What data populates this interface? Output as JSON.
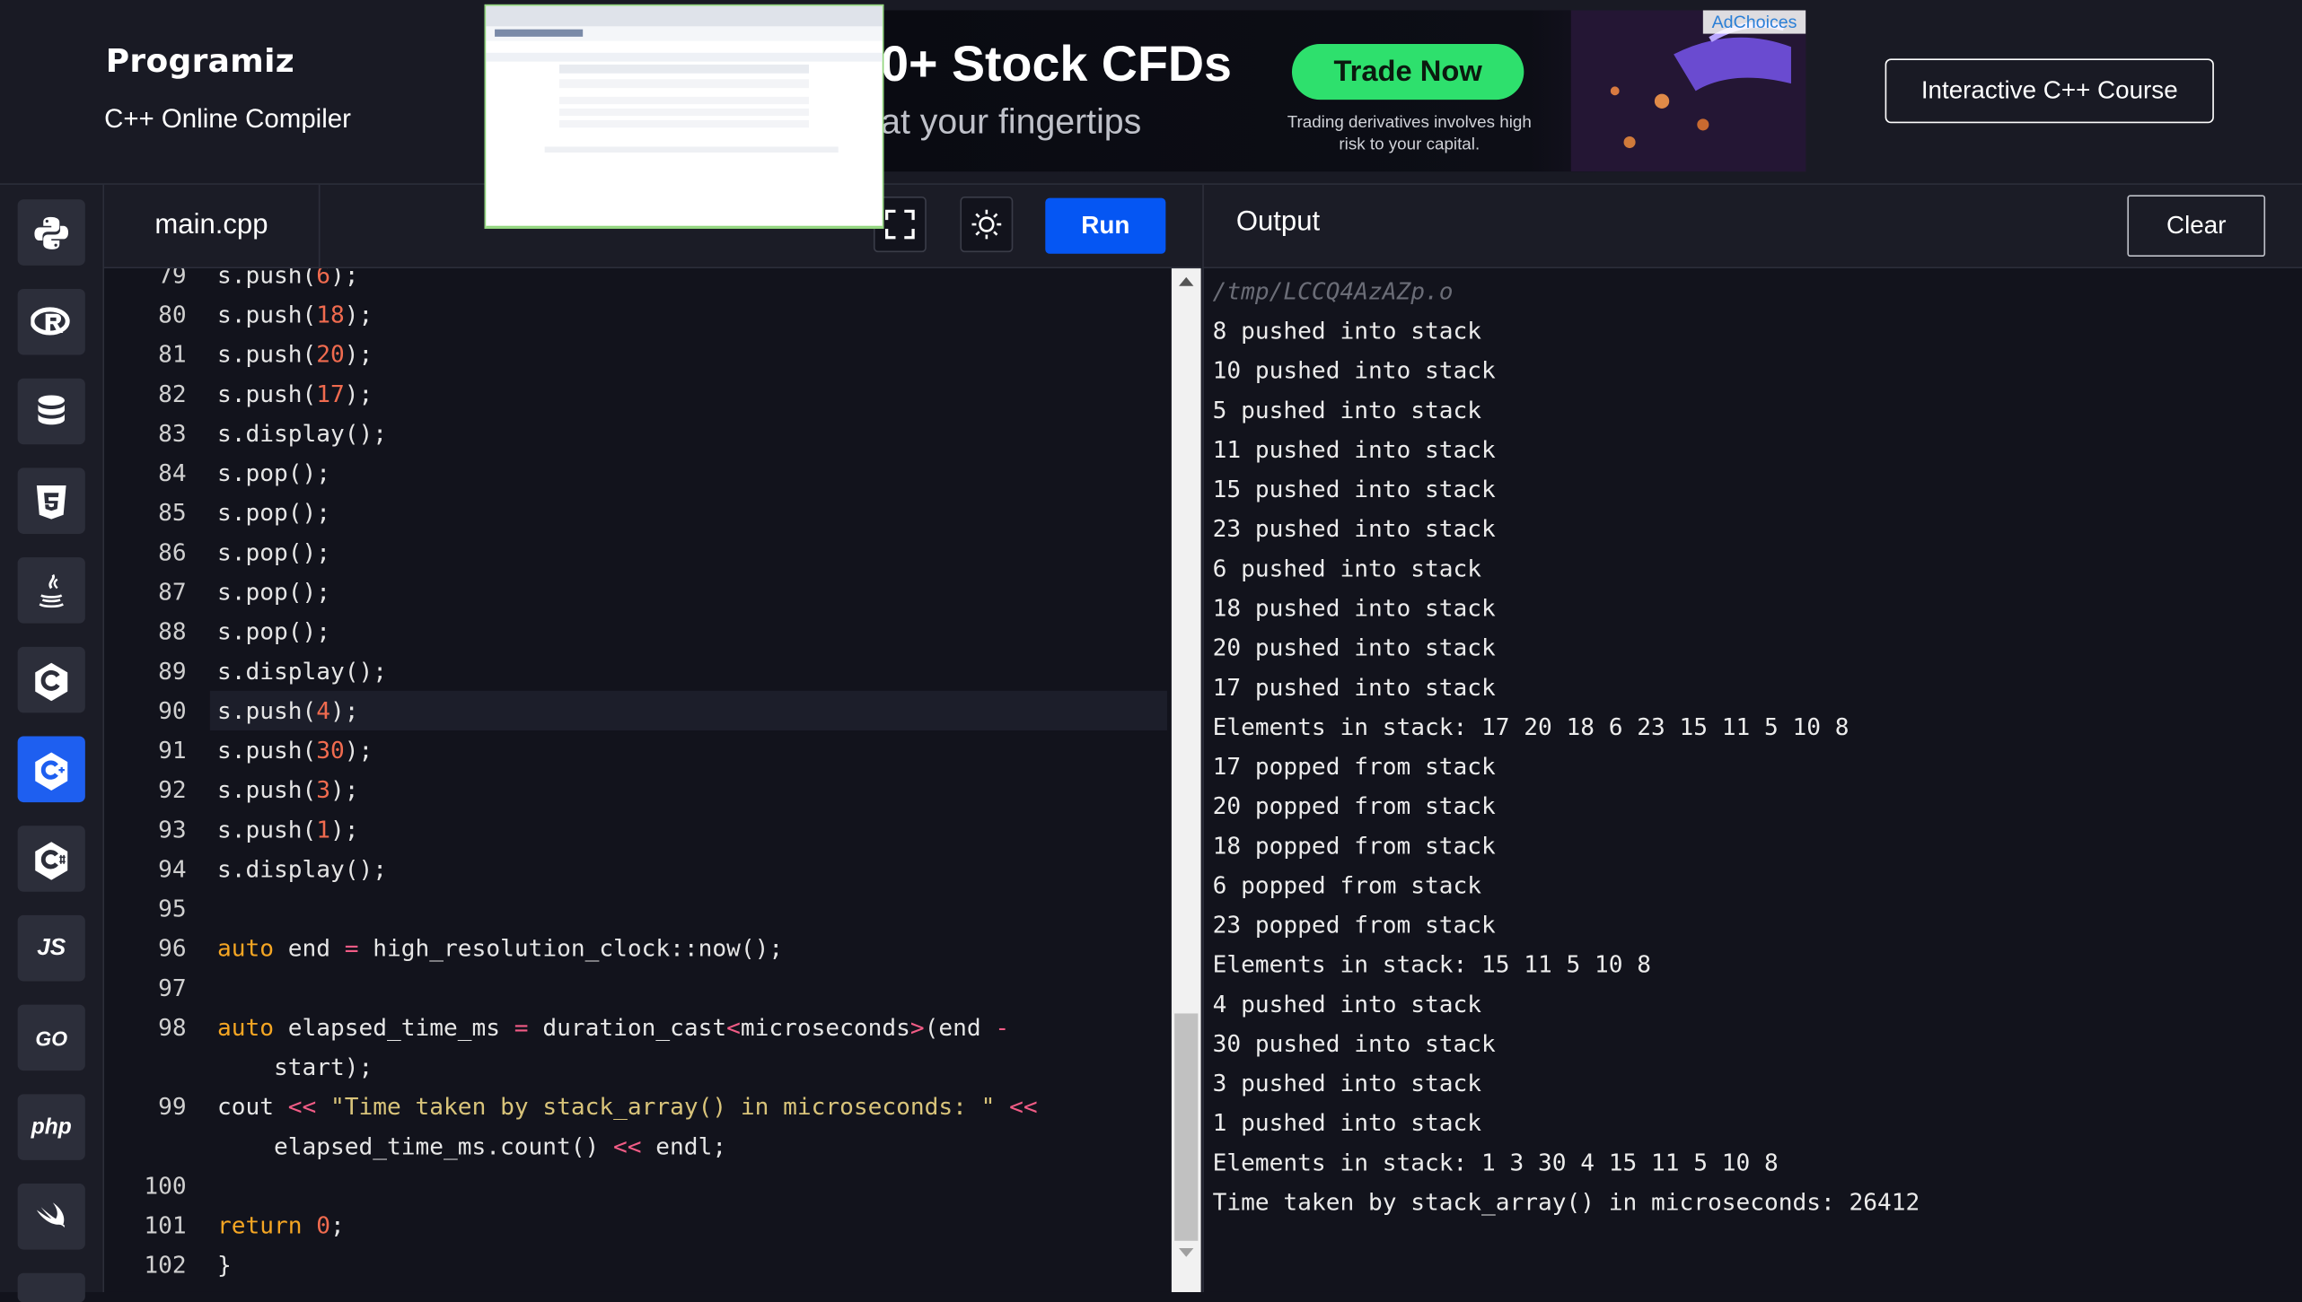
{
  "header": {
    "logo_text": "Programiz",
    "subtitle": "C++ Online Compiler",
    "course_button": "Interactive C++ Course"
  },
  "ad": {
    "headline": "0+ Stock CFDs",
    "tagline": "at your fingertips",
    "cta": "Trade Now",
    "disclaimer": "Trading derivatives involves high risk to your capital.",
    "adchoices": "AdChoices"
  },
  "sidebar": {
    "items": [
      {
        "name": "python",
        "label": ""
      },
      {
        "name": "r",
        "label": ""
      },
      {
        "name": "sql",
        "label": ""
      },
      {
        "name": "html",
        "label": ""
      },
      {
        "name": "java",
        "label": ""
      },
      {
        "name": "c",
        "label": ""
      },
      {
        "name": "cpp",
        "label": "",
        "active": true
      },
      {
        "name": "csharp",
        "label": ""
      },
      {
        "name": "js",
        "label": "JS"
      },
      {
        "name": "go",
        "label": "GO"
      },
      {
        "name": "php",
        "label": "php"
      },
      {
        "name": "swift",
        "label": ""
      }
    ]
  },
  "editor": {
    "filename": "main.cpp",
    "run_label": "Run",
    "current_line": "90",
    "lines": [
      {
        "n": "79",
        "parts": [
          [
            "",
            "s.push("
          ],
          [
            "num",
            "6"
          ],
          [
            "",
            ");"
          ]
        ]
      },
      {
        "n": "80",
        "parts": [
          [
            "",
            "s.push("
          ],
          [
            "num",
            "18"
          ],
          [
            "",
            ");"
          ]
        ]
      },
      {
        "n": "81",
        "parts": [
          [
            "",
            "s.push("
          ],
          [
            "num",
            "20"
          ],
          [
            "",
            ");"
          ]
        ]
      },
      {
        "n": "82",
        "parts": [
          [
            "",
            "s.push("
          ],
          [
            "num",
            "17"
          ],
          [
            "",
            ");"
          ]
        ]
      },
      {
        "n": "83",
        "parts": [
          [
            "",
            "s.display();"
          ]
        ]
      },
      {
        "n": "84",
        "parts": [
          [
            "",
            "s.pop();"
          ]
        ]
      },
      {
        "n": "85",
        "parts": [
          [
            "",
            "s.pop();"
          ]
        ]
      },
      {
        "n": "86",
        "parts": [
          [
            "",
            "s.pop();"
          ]
        ]
      },
      {
        "n": "87",
        "parts": [
          [
            "",
            "s.pop();"
          ]
        ]
      },
      {
        "n": "88",
        "parts": [
          [
            "",
            "s.pop();"
          ]
        ]
      },
      {
        "n": "89",
        "parts": [
          [
            "",
            "s.display();"
          ]
        ]
      },
      {
        "n": "90",
        "parts": [
          [
            "",
            "s.push("
          ],
          [
            "num",
            "4"
          ],
          [
            "",
            ");"
          ]
        ]
      },
      {
        "n": "91",
        "parts": [
          [
            "",
            "s.push("
          ],
          [
            "num",
            "30"
          ],
          [
            "",
            ");"
          ]
        ]
      },
      {
        "n": "92",
        "parts": [
          [
            "",
            "s.push("
          ],
          [
            "num",
            "3"
          ],
          [
            "",
            ");"
          ]
        ]
      },
      {
        "n": "93",
        "parts": [
          [
            "",
            "s.push("
          ],
          [
            "num",
            "1"
          ],
          [
            "",
            ");"
          ]
        ]
      },
      {
        "n": "94",
        "parts": [
          [
            "",
            "s.display();"
          ]
        ]
      },
      {
        "n": "95",
        "parts": []
      },
      {
        "n": "96",
        "parts": [
          [
            "kw",
            "auto"
          ],
          [
            "",
            " end "
          ],
          [
            "op",
            "="
          ],
          [
            "",
            " high_resolution_clock::now();"
          ]
        ]
      },
      {
        "n": "97",
        "parts": []
      },
      {
        "n": "98",
        "parts": [
          [
            "kw",
            "auto"
          ],
          [
            "",
            " elapsed_time_ms "
          ],
          [
            "op",
            "="
          ],
          [
            "",
            " duration_cast"
          ],
          [
            "op",
            "<"
          ],
          [
            "",
            "microseconds"
          ],
          [
            "op",
            ">"
          ],
          [
            "",
            "(end "
          ],
          [
            "op",
            "-"
          ]
        ]
      },
      {
        "n": "",
        "parts": [
          [
            "",
            "    start);"
          ]
        ]
      },
      {
        "n": "99",
        "parts": [
          [
            "",
            "cout "
          ],
          [
            "op",
            "<<"
          ],
          [
            "",
            " "
          ],
          [
            "str",
            "\"Time taken by stack_array() in microseconds: \""
          ],
          [
            "",
            " "
          ],
          [
            "op",
            "<<"
          ]
        ]
      },
      {
        "n": "",
        "parts": [
          [
            "",
            "    elapsed_time_ms.count() "
          ],
          [
            "op",
            "<<"
          ],
          [
            "",
            " endl;"
          ]
        ]
      },
      {
        "n": "100",
        "parts": []
      },
      {
        "n": "101",
        "parts": [
          [
            "kw",
            "return"
          ],
          [
            "",
            " "
          ],
          [
            "num",
            "0"
          ],
          [
            "",
            ";"
          ]
        ]
      },
      {
        "n": "102",
        "parts": [
          [
            "",
            "}"
          ]
        ]
      }
    ]
  },
  "output": {
    "title": "Output",
    "clear_label": "Clear",
    "path": "/tmp/LCCQ4AzAZp.o",
    "lines": [
      "8 pushed into stack",
      "10 pushed into stack",
      "5 pushed into stack",
      "11 pushed into stack",
      "15 pushed into stack",
      "23 pushed into stack",
      "6 pushed into stack",
      "18 pushed into stack",
      "20 pushed into stack",
      "17 pushed into stack",
      "Elements in stack: 17 20 18 6 23 15 11 5 10 8",
      "17 popped from stack",
      "20 popped from stack",
      "18 popped from stack",
      "6 popped from stack",
      "23 popped from stack",
      "Elements in stack: 15 11 5 10 8",
      "4 pushed into stack",
      "30 pushed into stack",
      "3 pushed into stack",
      "1 pushed into stack",
      "Elements in stack: 1 3 30 4 15 11 5 10 8",
      "Time taken by stack_array() in microseconds: 26412"
    ]
  }
}
